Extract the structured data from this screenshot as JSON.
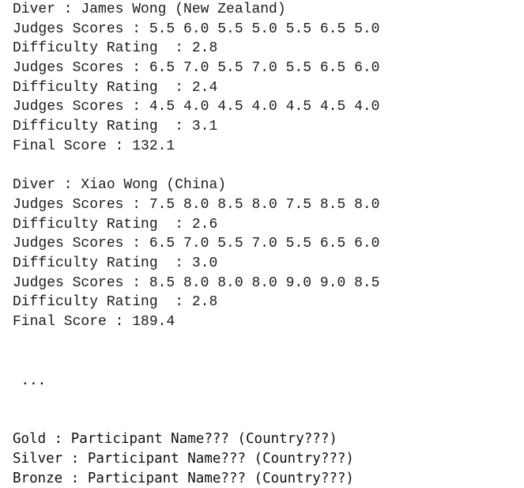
{
  "console": {
    "divers": [
      {
        "diver_line": "Diver : James Wong (New Zealand)",
        "diver_label": "Diver",
        "name": "James Wong",
        "country": "New Zealand",
        "dives": [
          {
            "scores_line": "Judges Scores : 5.5 6.0 5.5 5.0 5.5 6.5 5.0",
            "judges_scores": [
              5.5,
              6.0,
              5.5,
              5.0,
              5.5,
              6.5,
              5.0
            ],
            "difficulty_line": "Difficulty Rating  : 2.8",
            "difficulty": 2.8
          },
          {
            "scores_line": "Judges Scores : 6.5 7.0 5.5 7.0 5.5 6.5 6.0",
            "judges_scores": [
              6.5,
              7.0,
              5.5,
              7.0,
              5.5,
              6.5,
              6.0
            ],
            "difficulty_line": "Difficulty Rating  : 2.4",
            "difficulty": 2.4
          },
          {
            "scores_line": "Judges Scores : 4.5 4.0 4.5 4.0 4.5 4.5 4.0",
            "judges_scores": [
              4.5,
              4.0,
              4.5,
              4.0,
              4.5,
              4.5,
              4.0
            ],
            "difficulty_line": "Difficulty Rating  : 3.1",
            "difficulty": 3.1
          }
        ],
        "final_line": "Final Score : 132.1",
        "final_score": 132.1
      },
      {
        "diver_line": "Diver : Xiao Wong (China)",
        "diver_label": "Diver",
        "name": "Xiao Wong",
        "country": "China",
        "dives": [
          {
            "scores_line": "Judges Scores : 7.5 8.0 8.5 8.0 7.5 8.5 8.0",
            "judges_scores": [
              7.5,
              8.0,
              8.5,
              8.0,
              7.5,
              8.5,
              8.0
            ],
            "difficulty_line": "Difficulty Rating  : 2.6",
            "difficulty": 2.6
          },
          {
            "scores_line": "Judges Scores : 6.5 7.0 5.5 7.0 5.5 6.5 6.0",
            "judges_scores": [
              6.5,
              7.0,
              5.5,
              7.0,
              5.5,
              6.5,
              6.0
            ],
            "difficulty_line": "Difficulty Rating  : 3.0",
            "difficulty": 3.0
          },
          {
            "scores_line": "Judges Scores : 8.5 8.0 8.0 8.0 9.0 9.0 8.5",
            "judges_scores": [
              8.5,
              8.0,
              8.0,
              8.0,
              9.0,
              9.0,
              8.5
            ],
            "difficulty_line": "Difficulty Rating  : 2.8",
            "difficulty": 2.8
          }
        ],
        "final_line": "Final Score : 189.4",
        "final_score": 189.4
      }
    ],
    "ellipsis": " ...",
    "results": [
      "Gold : Participant Name??? (Country???)",
      "Silver : Participant Name??? (Country???)",
      "Bronze : Participant Name??? (Country???)"
    ]
  }
}
